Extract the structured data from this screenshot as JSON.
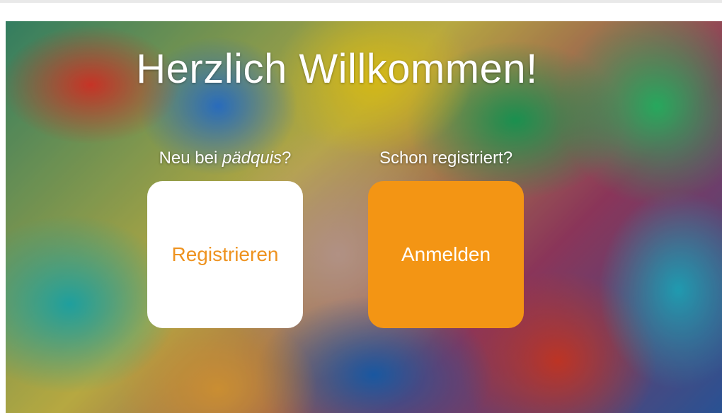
{
  "hero": {
    "title": "Herzlich Willkommen!"
  },
  "register": {
    "question_prefix": "Neu bei ",
    "brand": "pädquis",
    "question_suffix": "?",
    "button_label": "Registrieren"
  },
  "login": {
    "question": "Schon registriert?",
    "button_label": "Anmelden"
  },
  "colors": {
    "accent": "#f39514",
    "white": "#ffffff"
  }
}
